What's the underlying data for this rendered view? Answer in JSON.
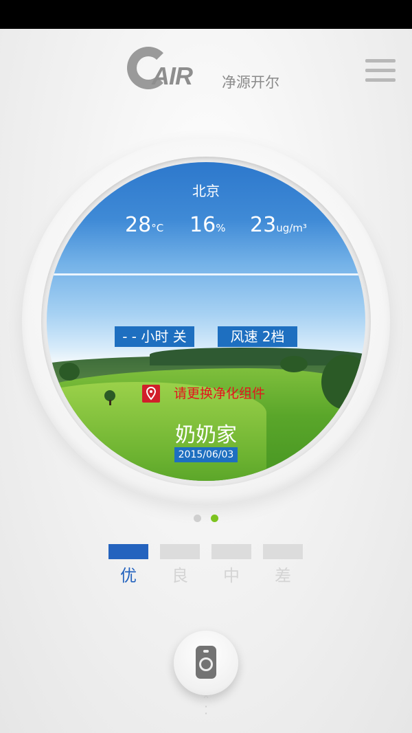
{
  "header": {
    "logo_letter_c": "C",
    "logo_air": "AIR",
    "brand_cn": "净源开尔",
    "menu_icon": "hamburger-icon"
  },
  "panel": {
    "city": "北京",
    "temperature": {
      "value": "28",
      "unit": "°C"
    },
    "humidity": {
      "value": "16",
      "unit": "%"
    },
    "pm25": {
      "value": "23",
      "unit": "ug/m³"
    },
    "timer_label": "- - 小时 关",
    "fan_speed_label": "风速 2档",
    "warning_text": "请更换净化组件",
    "warning_icon": "location-pin-icon",
    "device_name": "奶奶家",
    "date": "2015/06/03"
  },
  "pager": {
    "count": 2,
    "active_index": 1,
    "active_color": "#7cc31f",
    "inactive_color": "#cfcfcf"
  },
  "air_quality": {
    "levels": [
      "优",
      "良",
      "中",
      "差"
    ],
    "active_index": 0,
    "active_color": "#2463be",
    "inactive_color": "#dcdcdc"
  },
  "footer": {
    "remote_icon": "remote-control-icon",
    "expand_icon": "chevron-up-icon"
  }
}
